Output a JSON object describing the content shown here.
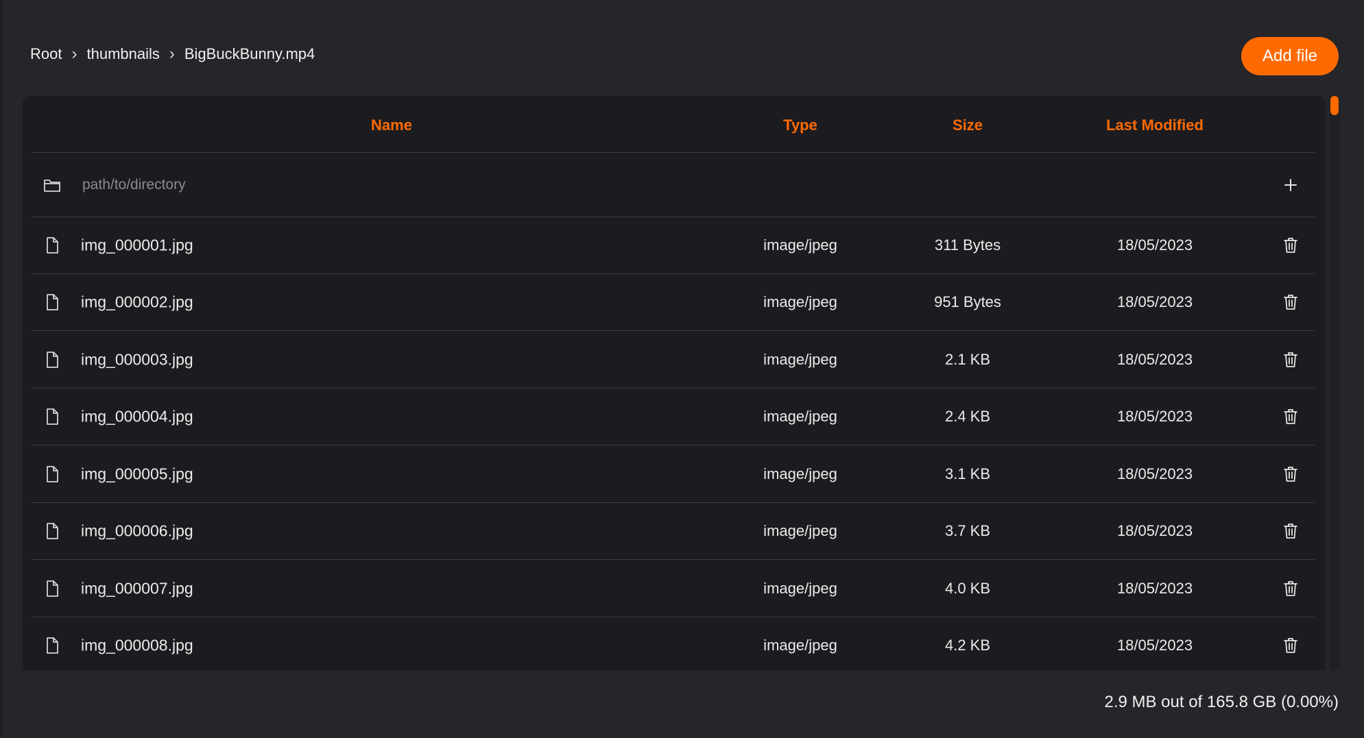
{
  "breadcrumb": {
    "items": [
      "Root",
      "thumbnails",
      "BigBuckBunny.mp4"
    ],
    "separator": "›"
  },
  "toolbar": {
    "add_file_label": "Add file"
  },
  "table": {
    "headers": {
      "name": "Name",
      "type": "Type",
      "size": "Size",
      "modified": "Last Modified"
    },
    "new_path": {
      "placeholder": "path/to/directory",
      "icon": "folder-icon",
      "action_icon": "plus-icon"
    },
    "rows": [
      {
        "name": "img_000001.jpg",
        "type": "image/jpeg",
        "size": "311 Bytes",
        "modified": "18/05/2023"
      },
      {
        "name": "img_000002.jpg",
        "type": "image/jpeg",
        "size": "951 Bytes",
        "modified": "18/05/2023"
      },
      {
        "name": "img_000003.jpg",
        "type": "image/jpeg",
        "size": "2.1 KB",
        "modified": "18/05/2023"
      },
      {
        "name": "img_000004.jpg",
        "type": "image/jpeg",
        "size": "2.4 KB",
        "modified": "18/05/2023"
      },
      {
        "name": "img_000005.jpg",
        "type": "image/jpeg",
        "size": "3.1 KB",
        "modified": "18/05/2023"
      },
      {
        "name": "img_000006.jpg",
        "type": "image/jpeg",
        "size": "3.7 KB",
        "modified": "18/05/2023"
      },
      {
        "name": "img_000007.jpg",
        "type": "image/jpeg",
        "size": "4.0 KB",
        "modified": "18/05/2023"
      },
      {
        "name": "img_000008.jpg",
        "type": "image/jpeg",
        "size": "4.2 KB",
        "modified": "18/05/2023"
      }
    ],
    "row_icon": "file-icon",
    "row_action_icon": "trash-icon"
  },
  "storage": {
    "usage_text": "2.9 MB out of 165.8 GB (0.00%)"
  },
  "colors": {
    "accent": "#ff6a00",
    "background": "#25252a",
    "panel": "#1c1c20",
    "text": "#ececec",
    "muted": "#8b8b8f"
  }
}
